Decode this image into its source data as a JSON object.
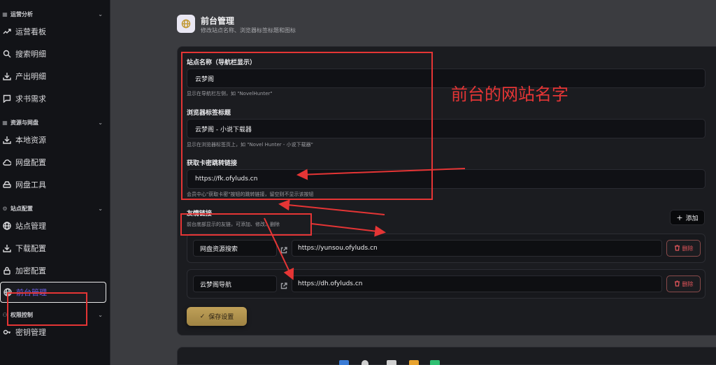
{
  "sidebar": {
    "groups": {
      "analytics": "运营分析",
      "resources": "资源与网盘",
      "site": "站点配置",
      "permission": "权限控制"
    },
    "items": {
      "dashboard": "运营看板",
      "search_detail": "搜索明细",
      "output_detail": "产出明细",
      "book_request": "求书需求",
      "local_resources": "本地资源",
      "netdisk_config": "网盘配置",
      "netdisk_tools": "网盘工具",
      "site_manage": "站点管理",
      "download_config": "下载配置",
      "encrypt_config": "加密配置",
      "frontend_manage": "前台管理",
      "key_manage": "密钥管理"
    }
  },
  "header": {
    "title": "前台管理",
    "subtitle": "修改站点名称、浏览器标签标题和图标"
  },
  "form": {
    "site_name": {
      "label": "站点名称（导航栏显示）",
      "value": "云梦阁",
      "hint": "显示在导航栏左侧，如 \"NovelHunter\""
    },
    "browser_title": {
      "label": "浏览器标签标题",
      "value": "云梦阁 - 小说下载器",
      "hint": "显示在浏览器标签页上，如 \"Novel Hunter - 小说下载器\""
    },
    "card_link": {
      "label": "获取卡密跳转链接",
      "value": "https://fk.ofyluds.cn",
      "hint": "会员中心\"获取卡密\"按钮的跳转链接，留空则不显示该按钮"
    },
    "friend_links": {
      "label": "友情链接",
      "hint": "前台底部显示的友链，可添加、修改、删除",
      "add_label": "添加",
      "delete_label": "删除",
      "rows": [
        {
          "name": "网盘资源搜索",
          "url": "https://yunsou.ofyluds.cn"
        },
        {
          "name": "云梦阁导航",
          "url": "https://dh.ofyluds.cn"
        }
      ]
    },
    "save_label": "保存设置"
  },
  "annotation": {
    "text": "前台的网站名字",
    "color": "#e53535"
  },
  "colors": {
    "accent": "#6f60e6",
    "gold": "#bfa058",
    "danger": "#e0555a"
  }
}
